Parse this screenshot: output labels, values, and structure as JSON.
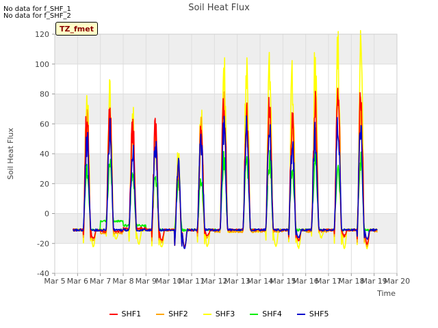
{
  "notes": {
    "line1": "No data for f_SHF_1",
    "line2": "No data for f_SHF_2",
    "tz_label": "TZ_fmet"
  },
  "chart_data": {
    "type": "line",
    "title": "Soil Heat Flux",
    "xlabel": "Time",
    "ylabel": "Soil Heat Flux",
    "ylim": [
      -40,
      120
    ],
    "yticks": [
      -40,
      -20,
      0,
      20,
      40,
      60,
      80,
      100,
      120
    ],
    "xlim": [
      5,
      20
    ],
    "xticks": [
      "Mar 5",
      "Mar 6",
      "Mar 7",
      "Mar 8",
      "Mar 9",
      "Mar 10",
      "Mar 11",
      "Mar 12",
      "Mar 13",
      "Mar 14",
      "Mar 15",
      "Mar 16",
      "Mar 17",
      "Mar 18",
      "Mar 19",
      "Mar 20"
    ],
    "grid": true,
    "legend_position": "bottom",
    "colors": {
      "SHF1": "#ff0000",
      "SHF2": "#ffa500",
      "SHF3": "#ffff00",
      "SHF4": "#00ee00",
      "SHF5": "#0000cc"
    },
    "data_start_day": 5.8,
    "data_end_day": 19.15,
    "daily_peaks": {
      "days": [
        6,
        7,
        8,
        9,
        10,
        11,
        12,
        13,
        14,
        15,
        16,
        17,
        18,
        19
      ],
      "SHF1": [
        67,
        67,
        56,
        56,
        32,
        65,
        79,
        67,
        76,
        62,
        69,
        76,
        75,
        63
      ],
      "SHF2": [
        60,
        62,
        50,
        50,
        30,
        58,
        70,
        60,
        68,
        50,
        62,
        70,
        68,
        56
      ],
      "SHF3": [
        79,
        91,
        66,
        55,
        38,
        73,
        95,
        94,
        98,
        90,
        96,
        107,
        106,
        95
      ],
      "SHF4": [
        30,
        34,
        25,
        25,
        21,
        23,
        36,
        35,
        35,
        31,
        34,
        34,
        34,
        22
      ],
      "SHF5": [
        48,
        55,
        43,
        45,
        33,
        48,
        56,
        54,
        56,
        46,
        55,
        57,
        55,
        51
      ]
    },
    "daily_minima": {
      "SHF1": [
        -17,
        -12,
        -10,
        -18,
        -22,
        -15,
        -11,
        -11,
        -11,
        -18,
        -11,
        -15,
        -20,
        -11
      ],
      "SHF2": [
        -18,
        -13,
        -11,
        -19,
        -22,
        -16,
        -12,
        -12,
        -12,
        -18,
        -12,
        -16,
        -22,
        -12
      ],
      "SHF3": [
        -22,
        -17,
        -20,
        -23,
        -23,
        -22,
        -12,
        -12,
        -22,
        -23,
        -16,
        -23,
        -23,
        -21
      ],
      "SHF4": [
        -11,
        -5,
        -8,
        -11,
        -11,
        -11,
        -11,
        -11,
        -11,
        -11,
        -11,
        -11,
        -11,
        -11
      ],
      "SHF5": [
        -11,
        -11,
        -11,
        -11,
        -23,
        -11,
        -11,
        -11,
        -11,
        -16,
        -11,
        -11,
        -17,
        -11
      ]
    },
    "series_names": [
      "SHF1",
      "SHF2",
      "SHF3",
      "SHF4",
      "SHF5"
    ]
  }
}
